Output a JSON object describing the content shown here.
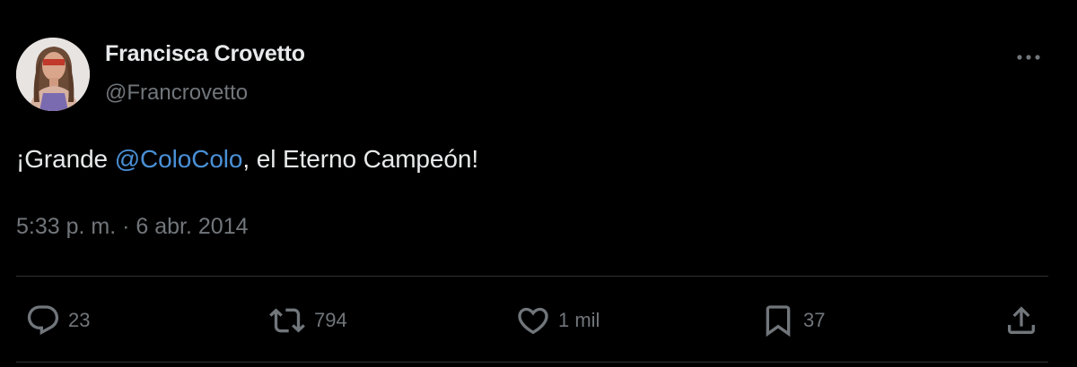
{
  "tweet": {
    "author_name": "Francisca Crovetto",
    "author_handle": "@Francrovetto",
    "text_before": "¡Grande ",
    "mention": "@ColoColo",
    "text_after": ", el Eterno Campeón!",
    "timestamp": "5:33 p. m. · 6 abr. 2014"
  },
  "actions": {
    "replies": "23",
    "reposts": "794",
    "likes": "1 mil",
    "bookmarks": "37"
  },
  "icons": {
    "more": "more-horizontal-icon",
    "reply": "reply-icon",
    "repost": "repost-icon",
    "like": "heart-icon",
    "bookmark": "bookmark-icon",
    "share": "share-icon"
  },
  "colors": {
    "background": "#000000",
    "primary_text": "#e7e9ea",
    "secondary_text": "#71767b",
    "mention": "#4a90d6",
    "divider": "#2f3336"
  }
}
